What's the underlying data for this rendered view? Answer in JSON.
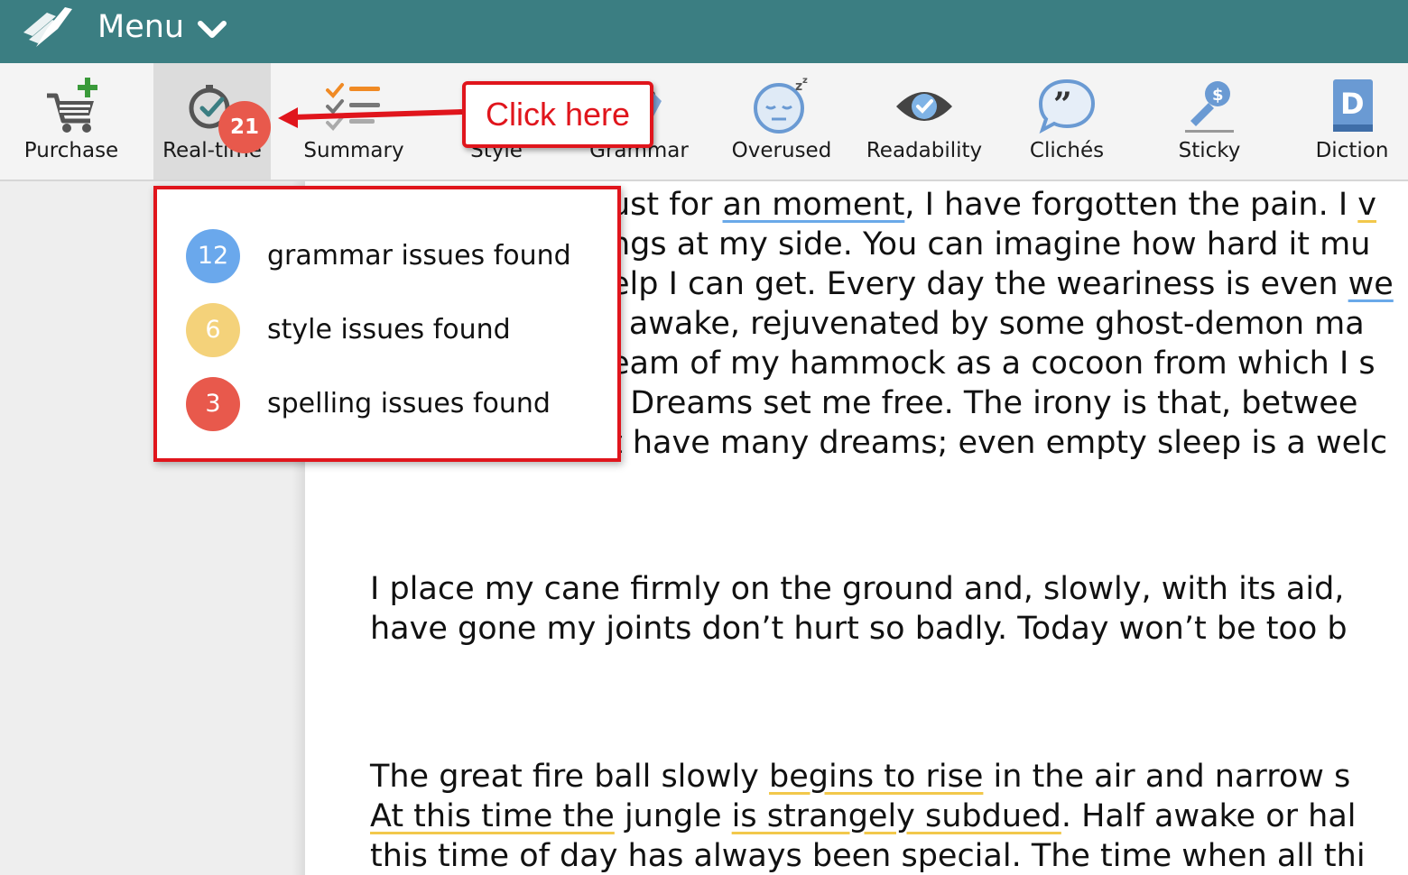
{
  "header": {
    "menu_label": "Menu"
  },
  "toolbar": {
    "items": [
      {
        "id": "purchase",
        "label": "Purchase",
        "icon": "cart-plus-icon"
      },
      {
        "id": "realtime",
        "label": "Real-time",
        "icon": "clock-check-icon",
        "badge": "21",
        "active": true
      },
      {
        "id": "summary",
        "label": "Summary",
        "icon": "checklist-icon"
      },
      {
        "id": "style",
        "label": "Style",
        "icon": "style-icon"
      },
      {
        "id": "grammar",
        "label": "Grammar",
        "icon": "grammar-icon"
      },
      {
        "id": "overused",
        "label": "Overused",
        "icon": "sleepy-face-icon"
      },
      {
        "id": "readability",
        "label": "Readability",
        "icon": "eye-icon"
      },
      {
        "id": "cliches",
        "label": "Clichés",
        "icon": "quote-bubble-icon"
      },
      {
        "id": "sticky",
        "label": "Sticky",
        "icon": "sticky-pen-icon"
      },
      {
        "id": "diction",
        "label": "Diction",
        "icon": "dictionary-icon"
      }
    ]
  },
  "callout": {
    "text": "Click here"
  },
  "popup": {
    "issues": [
      {
        "count": "12",
        "label": "grammar issues found",
        "color": "#6aa8ec"
      },
      {
        "count": "6",
        "label": "style issues found",
        "color": "#f4d27a"
      },
      {
        "count": "3",
        "label": "spelling issues found",
        "color": "#e8594c"
      }
    ]
  },
  "document": {
    "p1": {
      "l1_a": "ust for ",
      "l1_b": "an moment",
      "l1_c": ", I have forgotten the pain. I ",
      "l1_d": "v",
      "l2": "ngs at my side. You can imagine how hard it mu",
      "l3_a": "elp I can get. Every day the weariness is even ",
      "l3_b": "we",
      "l4": "l awake, rejuvenated by some ghost-demon ma",
      "l5": "eam of my hammock as a cocoon from which I s",
      "l6": ". Dreams set me free. The irony is that, betwee",
      "l7": "t have many dreams; even empty sleep is a welc"
    },
    "p2": {
      "l1": "I place my cane firmly on the ground and, slowly, with its aid, ",
      "l2": "have gone my joints don’t hurt so badly. Today won’t be too b"
    },
    "p3": {
      "l1_a": "The great fire ball slowly ",
      "l1_b": "begins to rise",
      "l1_c": " in the air and narrow s",
      "l2_a": "At this time the",
      "l2_b": " jungle ",
      "l2_c": "is strangely subdued",
      "l2_d": ". Half awake or hal",
      "l3": "this time of day has always been special. The time when all thi"
    }
  }
}
